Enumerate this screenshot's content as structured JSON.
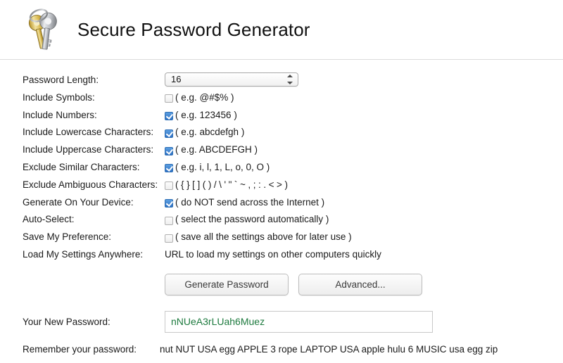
{
  "header": {
    "title": "Secure Password Generator",
    "icon": "keys-icon"
  },
  "form": {
    "rows": [
      {
        "label": "Password Length:",
        "type": "select",
        "value": "16"
      },
      {
        "label": "Include Symbols:",
        "type": "checkbox",
        "checked": false,
        "hint": "( e.g. @#$% )"
      },
      {
        "label": "Include Numbers:",
        "type": "checkbox",
        "checked": true,
        "hint": "( e.g. 123456 )"
      },
      {
        "label": "Include Lowercase Characters:",
        "type": "checkbox",
        "checked": true,
        "hint": "( e.g. abcdefgh )"
      },
      {
        "label": "Include Uppercase Characters:",
        "type": "checkbox",
        "checked": true,
        "hint": "( e.g. ABCDEFGH )"
      },
      {
        "label": "Exclude Similar Characters:",
        "type": "checkbox",
        "checked": true,
        "hint": "( e.g. i, l, 1, L, o, 0, O )"
      },
      {
        "label": "Exclude Ambiguous Characters:",
        "type": "checkbox",
        "checked": false,
        "hint": "( { } [ ] ( ) / \\ ' \" ` ~ , ; : . < > )"
      },
      {
        "label": "Generate On Your Device:",
        "type": "checkbox",
        "checked": true,
        "hint": "( do NOT send across the Internet )"
      },
      {
        "label": "Auto-Select:",
        "type": "checkbox",
        "checked": false,
        "hint": "( select the password automatically )"
      },
      {
        "label": "Save My Preference:",
        "type": "checkbox",
        "checked": false,
        "hint": "( save all the settings above for later use )"
      },
      {
        "label": "Load My Settings Anywhere:",
        "type": "text",
        "value": "URL to load my settings on other computers quickly"
      }
    ],
    "length_options": [
      "16"
    ]
  },
  "actions": {
    "generate_label": "Generate Password",
    "advanced_label": "Advanced..."
  },
  "result": {
    "password_label": "Your New Password:",
    "password_value": "nNUeA3rLUah6Muez",
    "remember_label": "Remember your password:",
    "remember_value": "nut NUT USA egg APPLE 3 rope LAPTOP USA apple hulu 6 MUSIC usa egg zip"
  },
  "colors": {
    "password_text": "#1d7a3e",
    "checkbox_checked": "#2f72c4",
    "divider": "#dcdcdc"
  }
}
